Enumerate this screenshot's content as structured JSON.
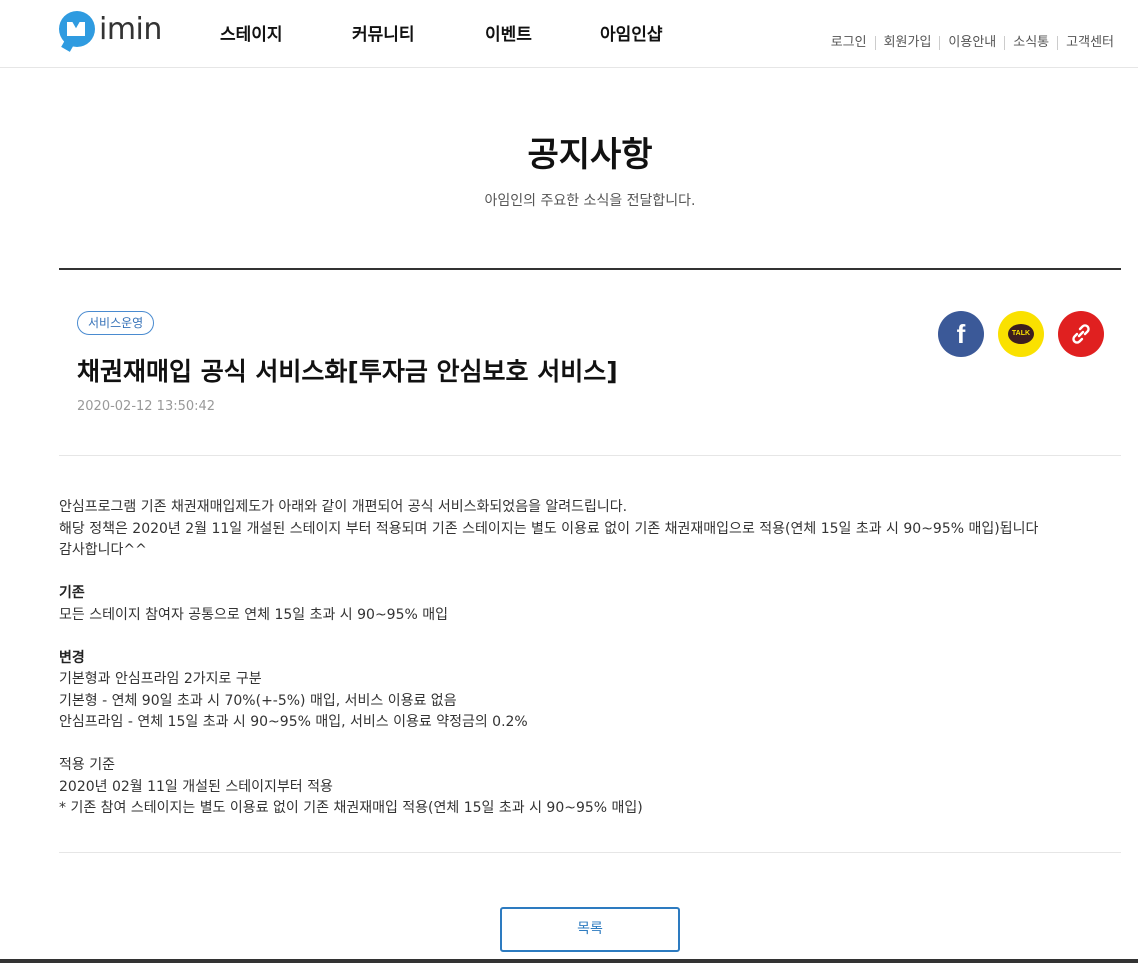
{
  "header": {
    "logo_text": "imin",
    "nav": [
      "스테이지",
      "커뮤니티",
      "이벤트",
      "아임인샵"
    ],
    "util": [
      "로그인",
      "회원가입",
      "이용안내",
      "소식통",
      "고객센터"
    ]
  },
  "page": {
    "title": "공지사항",
    "subtitle": "아임인의 주요한 소식을 전달합니다."
  },
  "article": {
    "tag": "서비스운영",
    "title": "채권재매입 공식 서비스화[투자금 안심보호 서비스]",
    "date": "2020-02-12 13:50:42",
    "share": {
      "facebook": "f",
      "kakao": "TALK"
    },
    "body": {
      "intro": [
        "안심프로그램 기존 채권재매입제도가 아래와 같이 개편되어 공식 서비스화되었음을 알려드립니다.",
        "해당 정책은 2020년 2월 11일 개설된 스테이지 부터 적용되며 기존 스테이지는 별도 이용료 없이 기존 채권재매입으로 적용(연체 15일 초과 시 90~95% 매입)됩니다",
        "감사합니다^^"
      ],
      "section1_title": "기존",
      "section1": [
        "모든 스테이지 참여자 공통으로 연체 15일 초과 시 90~95% 매입"
      ],
      "section2_title": "변경",
      "section2": [
        "기본형과 안심프라임 2가지로 구분",
        "기본형 - 연체 90일 초과 시 70%(+-5%) 매입, 서비스 이용료 없음",
        "안심프라임 - 연체 15일 초과 시 90~95% 매입, 서비스 이용료 약정금의 0.2%"
      ],
      "section3_title": "적용 기준",
      "section3": [
        "2020년 02월 11일 개설된 스테이지부터 적용",
        "* 기존 참여 스테이지는 별도 이용료 없이 기존 채권재매입 적용(연체 15일 초과 시 90~95% 매입)"
      ]
    }
  },
  "list_button": "목록"
}
